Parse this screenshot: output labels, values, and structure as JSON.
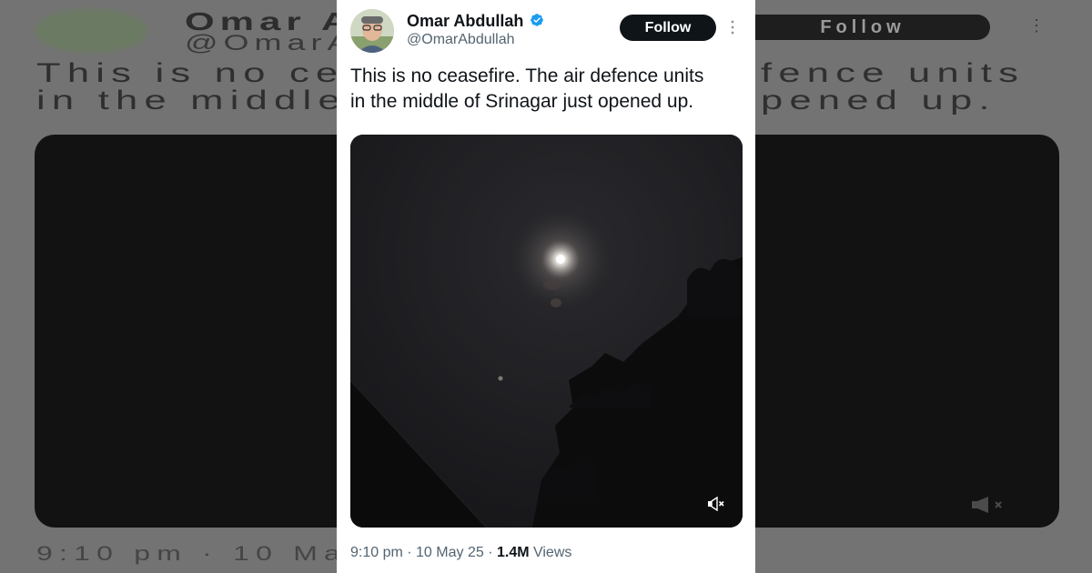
{
  "tweet": {
    "author": {
      "display_name": "Omar Abdullah",
      "handle": "@OmarAbdullah",
      "verified": true
    },
    "follow_label": "Follow",
    "text_lines": [
      "This is no ceasefire. The air defence units",
      "in the middle of Srinagar just opened up."
    ],
    "timestamp": "9:10 pm · 10 May 25",
    "separator": " · ",
    "views_count": "1.4M",
    "views_label": " Views"
  },
  "background_echo": {
    "name_fragment": "Omar A",
    "handle_fragment": "@OmarA",
    "text_left_line1": "This is no cea",
    "text_left_line2": "in the middle",
    "text_right_line1": "fence units",
    "text_right_line2": "pened up.",
    "follow_label": "Follow",
    "time_fragment": "9:10 pm · 10 Ma"
  },
  "colors": {
    "card_bg": "#ffffff",
    "text_primary": "#0f1419",
    "text_secondary": "#536471",
    "verified_blue": "#1d9bf0",
    "follow_bg": "#0f1419",
    "backdrop": "#737373"
  },
  "icons": {
    "verified": "verified-badge-icon",
    "more": "more-options-icon",
    "mute": "speaker-muted-icon"
  }
}
